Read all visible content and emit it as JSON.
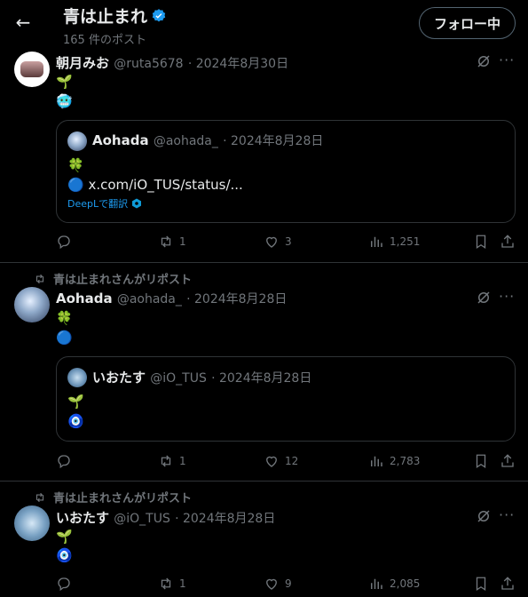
{
  "header": {
    "title": "青は止まれ",
    "post_count": "165 件のポスト",
    "follow_label": "フォロー中"
  },
  "tweets": [
    {
      "name": "朝月みお",
      "handle": "@ruta5678",
      "date": "· 2024年8月30日",
      "lines": [
        "🌱",
        "🥶"
      ],
      "quote": {
        "name": "Aohada",
        "handle": "@aohada_",
        "date": "· 2024年8月28日",
        "lines": [
          "🍀",
          "🔵 x.com/iO_TUS/status/..."
        ],
        "translate": "DeepLで翻訳"
      },
      "actions": {
        "replies": "",
        "reposts": "1",
        "likes": "3",
        "views": "1,251"
      }
    },
    {
      "repost_label": "青は止まれさんがリポスト",
      "name": "Aohada",
      "handle": "@aohada_",
      "date": "· 2024年8月28日",
      "lines": [
        "🍀",
        "🔵"
      ],
      "quote": {
        "name": "いおたす",
        "handle": "@iO_TUS",
        "date": "· 2024年8月28日",
        "lines": [
          "🌱",
          "🧿"
        ]
      },
      "actions": {
        "replies": "",
        "reposts": "1",
        "likes": "12",
        "views": "2,783"
      }
    },
    {
      "repost_label": "青は止まれさんがリポスト",
      "name": "いおたす",
      "handle": "@iO_TUS",
      "date": "· 2024年8月28日",
      "lines": [
        "🌱",
        "🧿"
      ],
      "actions": {
        "replies": "",
        "reposts": "1",
        "likes": "9",
        "views": "2,085"
      }
    }
  ],
  "colors": {
    "accent": "#1d9bf0",
    "muted": "#71767b",
    "border": "#2f3336",
    "background": "#000000"
  }
}
